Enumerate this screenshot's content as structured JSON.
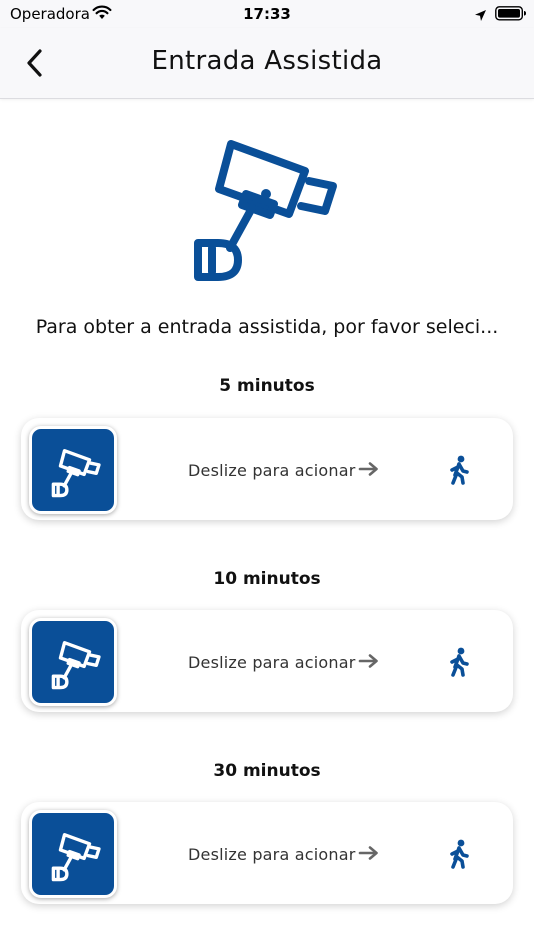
{
  "status_bar": {
    "carrier": "Operadora",
    "time": "17:33",
    "icons": [
      "wifi-icon",
      "location-arrow-icon",
      "battery-icon"
    ]
  },
  "nav": {
    "title": "Entrada Assistida",
    "back_icon": "chevron-left-icon"
  },
  "hero_icon": "security-camera-icon",
  "instruction": "Para obter a entrada assistida, por favor seleci...",
  "options": [
    {
      "duration": "5 minutos",
      "swipe_label": "Deslize para acionar"
    },
    {
      "duration": "10 minutos",
      "swipe_label": "Deslize para acionar"
    },
    {
      "duration": "30 minutos",
      "swipe_label": "Deslize para acionar"
    }
  ],
  "colors": {
    "brand": "#0a4f98",
    "background": "#ffffff",
    "navbar": "#f8f8fa"
  }
}
